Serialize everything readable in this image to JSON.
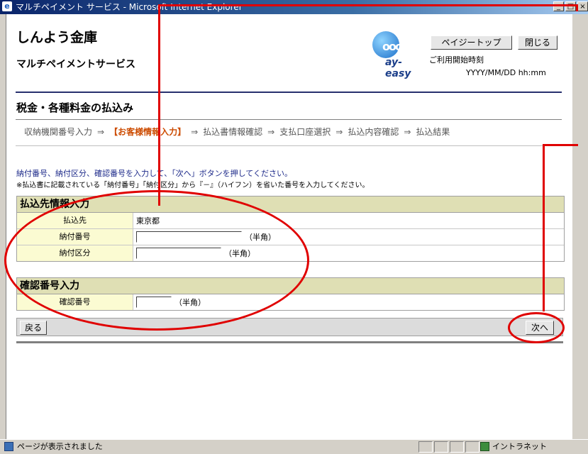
{
  "window": {
    "title": "マルチペイメント サービス - Microsoft Internet Explorer",
    "minimize": "_",
    "maximize": "□",
    "close": "×"
  },
  "header": {
    "bank_name": "しんよう金庫",
    "service_name": "マルチペイメントサービス",
    "logo_text": "ay-easy",
    "top_button": "ペイジートップ",
    "close_button": "閉じる",
    "login_label": "ご利用開始時刻",
    "login_value": "YYYY/MM/DD hh:mm"
  },
  "page": {
    "section_title": "税金・各種料金の払込み",
    "steps": [
      {
        "label": "収納機関番号入力",
        "current": false
      },
      {
        "label": "【お客様情報入力】",
        "current": true
      },
      {
        "label": "払込書情報確認",
        "current": false
      },
      {
        "label": "支払口座選択",
        "current": false
      },
      {
        "label": "払込内容確認",
        "current": false
      },
      {
        "label": "払込結果",
        "current": false
      }
    ],
    "arrow": "⇒",
    "instruction_1": "納付番号、納付区分、確認番号を入力して、「次へ」ボタンを押してください。",
    "instruction_2": "※払込書に記載されている「納付番号」「納付区分」から『－』（ハイフン）を省いた番号を入力してください。"
  },
  "payee_panel": {
    "heading": "払込先情報入力",
    "payee_label": "払込先",
    "payee_value": "東京都",
    "number_label": "納付番号",
    "number_value": "",
    "number_note": "（半角）",
    "category_label": "納付区分",
    "category_value": "",
    "category_note": "（半角）"
  },
  "confirm_panel": {
    "heading": "確認番号入力",
    "code_label": "確認番号",
    "code_value": "",
    "code_note": "（半角）"
  },
  "actions": {
    "back": "戻る",
    "next": "次へ"
  },
  "statusbar": {
    "text": "ページが表示されました",
    "zone": "イントラネット"
  },
  "colors": {
    "annotation": "#e00000",
    "current_step": "#cc4b00",
    "panel_head": "#dfdfb4",
    "label_bg": "#fbfbd2"
  }
}
